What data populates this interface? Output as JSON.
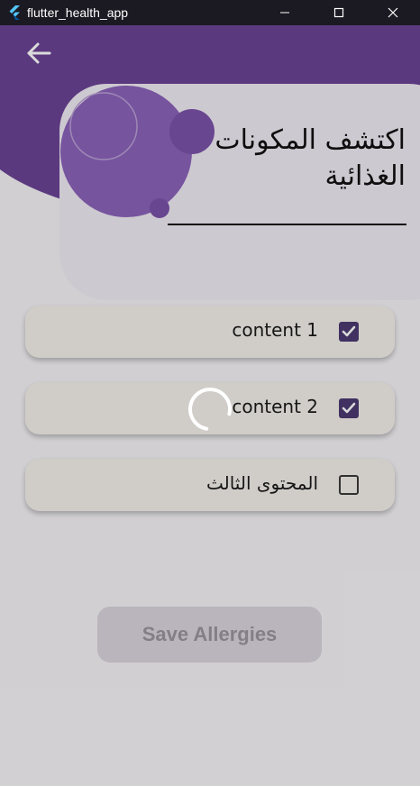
{
  "window": {
    "title": "flutter_health_app",
    "controls": [
      "minimize-icon",
      "maximize-icon",
      "close-icon"
    ]
  },
  "header": {
    "back_icon": "arrow-left-icon",
    "title": "اكتشف المكونات الغذائية"
  },
  "allergens": [
    {
      "label": "content 1",
      "checked": true
    },
    {
      "label": "content 2",
      "checked": true
    },
    {
      "label": "المحتوى الثالث",
      "checked": false
    }
  ],
  "save_button": {
    "label": "Save Allergies",
    "enabled": false
  },
  "loading": true,
  "colors": {
    "titlebar": "#1b1a22",
    "header_purple": "#6a4394",
    "bubble": "#8a62b8",
    "checkbox": "#4b3a72"
  }
}
